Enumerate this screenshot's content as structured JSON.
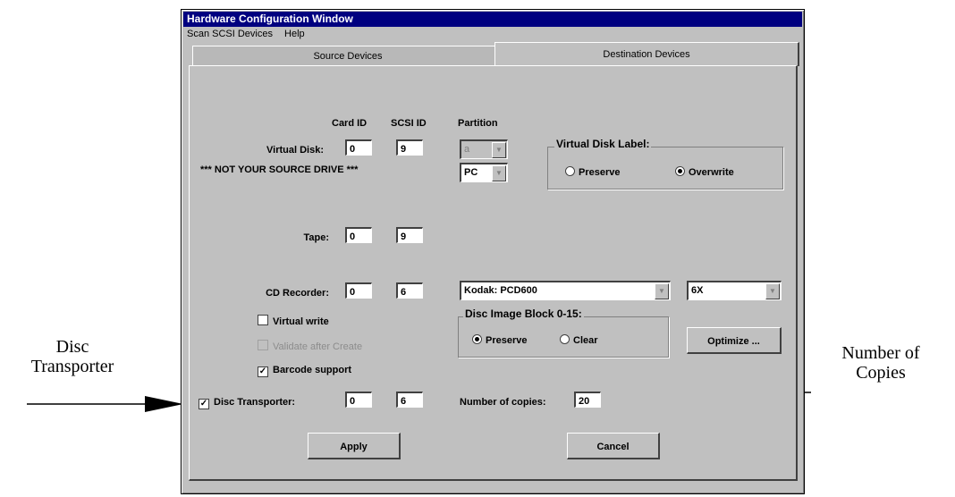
{
  "window": {
    "title": "Hardware Configuration Window",
    "menu": [
      "Scan SCSI Devices",
      "Help"
    ]
  },
  "tabs": [
    {
      "label": "Source Devices",
      "active": false
    },
    {
      "label": "Destination Devices",
      "active": true
    }
  ],
  "columns": {
    "card_id": "Card ID",
    "scsi_id": "SCSI ID",
    "partition": "Partition"
  },
  "virtual_disk": {
    "label": "Virtual Disk:",
    "card_id": "0",
    "scsi_id": "9",
    "partition": "a",
    "warning": "*** NOT YOUR SOURCE DRIVE ***",
    "type": "PC"
  },
  "virtual_disk_label": {
    "title": "Virtual Disk Label:",
    "preserve": "Preserve",
    "overwrite": "Overwrite",
    "selected": "Overwrite"
  },
  "tape": {
    "label": "Tape:",
    "card_id": "0",
    "scsi_id": "9"
  },
  "cd_recorder": {
    "label": "CD Recorder:",
    "card_id": "0",
    "scsi_id": "6",
    "model": "Kodak: PCD600",
    "speed": "6X"
  },
  "options": {
    "virtual_write": {
      "label": "Virtual write",
      "checked": false
    },
    "validate": {
      "label": "Validate after Create",
      "checked": false,
      "enabled": false
    },
    "barcode": {
      "label": "Barcode support",
      "checked": true
    }
  },
  "disc_image_block": {
    "title": "Disc Image Block 0-15:",
    "preserve": "Preserve",
    "clear": "Clear",
    "selected": "Preserve"
  },
  "optimize_label": "Optimize ...",
  "disc_transporter": {
    "label": "Disc Transporter:",
    "checked": true,
    "card_id": "0",
    "scsi_id": "6"
  },
  "copies": {
    "label": "Number of copies:",
    "value": "20"
  },
  "buttons": {
    "apply": "Apply",
    "cancel": "Cancel"
  },
  "annotations": {
    "left_line1": "Disc",
    "left_line2": "Transporter",
    "right_line1": "Number of",
    "right_line2": "Copies"
  }
}
